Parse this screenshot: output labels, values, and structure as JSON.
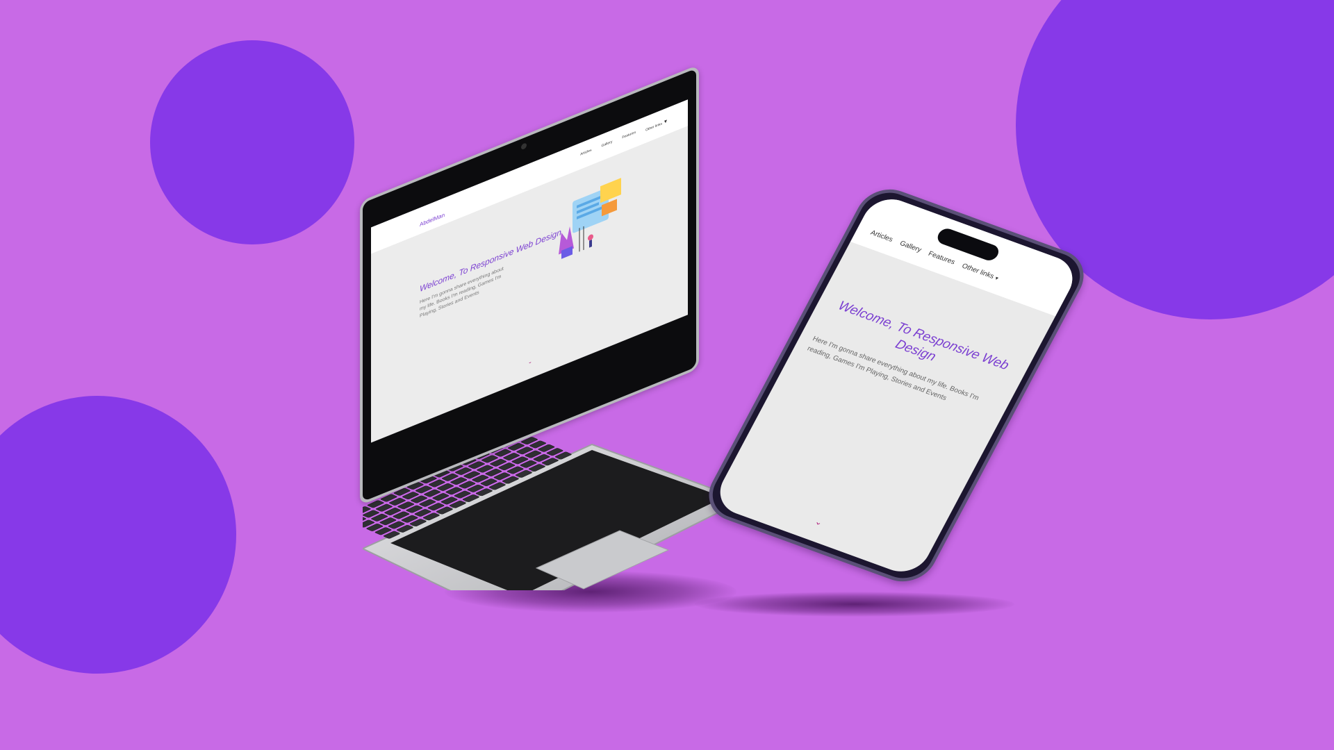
{
  "background": {
    "color": "#c86ae6",
    "circle_color": "#8739e8"
  },
  "laptop": {
    "site": {
      "logo": "AbdelMan",
      "nav_links": [
        "Articles",
        "Gallery",
        "Features",
        "Other links"
      ],
      "hero_title": "Welcome, To Responsive Web Design",
      "hero_text": "Here I'm gonna share everything about my life. Books I'm reading, Games I'm Playing, Stories and Events",
      "scroll_indicator": "chevron-down-icon"
    }
  },
  "phone": {
    "site": {
      "nav_links": [
        "Articles",
        "Gallery",
        "Features",
        "Other links"
      ],
      "dropdown_icon": "caret-down-icon",
      "hero_title": "Welcome, To Responsive Web Design",
      "hero_text": "Here I'm gonna share everything about my life. Books I'm reading, Games I'm Playing, Stories and Events",
      "scroll_indicator": "chevron-down-icon"
    }
  }
}
